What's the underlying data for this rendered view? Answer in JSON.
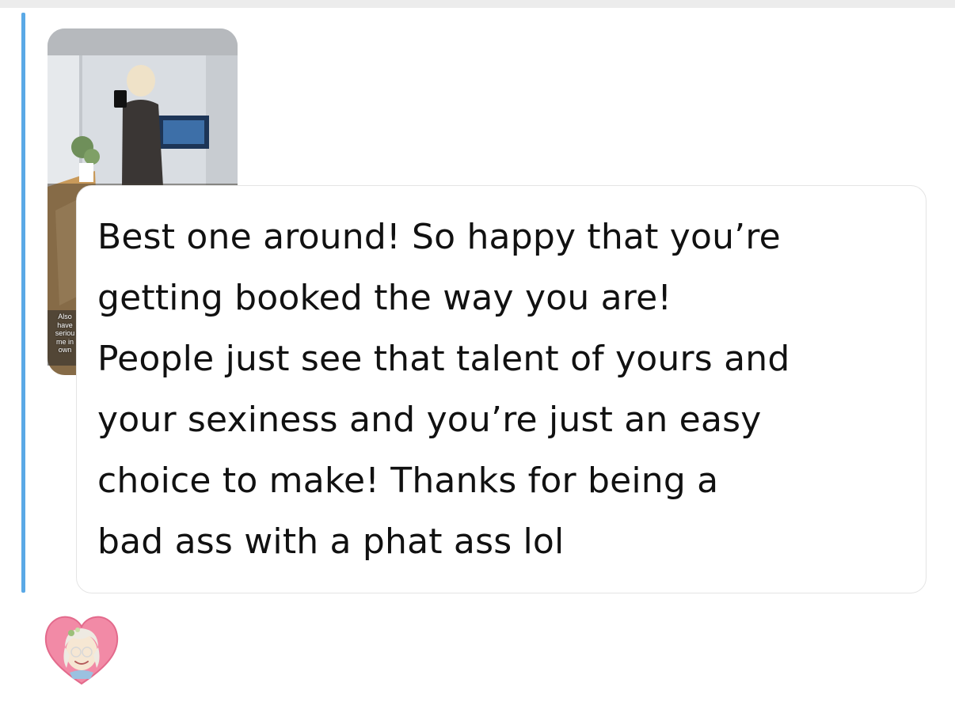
{
  "chat": {
    "story_reply": {
      "caption": "Also\nhave\nseriou\nme in\nown"
    },
    "message": {
      "text": "Best one around! So happy that you’re\ngetting booked the way you are!\nPeople just see that talent of yours and\nyour sexiness and you’re just an easy\nchoice to make! Thanks for being a\nbad ass with a phat ass lol"
    },
    "reaction": {
      "icon": "heart-bitmoji-icon"
    }
  },
  "colors": {
    "reply_bar": "#5aa9e6",
    "bubble_border": "#e4e4e4",
    "text": "#111111",
    "heart": "#f28aa6"
  }
}
